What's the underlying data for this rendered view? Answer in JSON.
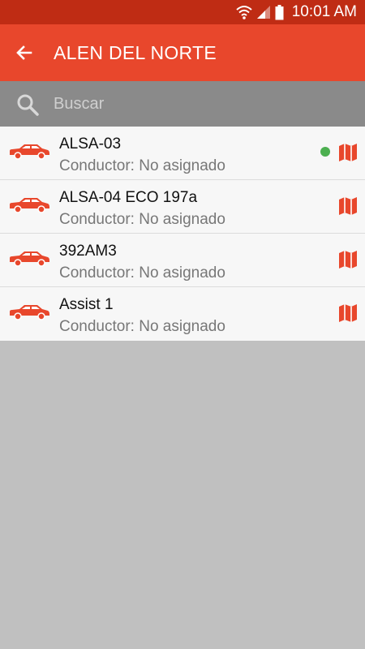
{
  "status_bar": {
    "time": "10:01 AM",
    "icons": [
      "wifi-icon",
      "signal-icon",
      "battery-icon"
    ]
  },
  "app_bar": {
    "back_icon": "arrow-left-icon",
    "title": "ALEN DEL NORTE"
  },
  "search": {
    "placeholder": "Buscar",
    "value": ""
  },
  "vehicles": [
    {
      "name": "ALSA-03",
      "driver": "Conductor: No asignado",
      "online": true
    },
    {
      "name": "ALSA-04 ECO 197a",
      "driver": "Conductor: No asignado",
      "online": false
    },
    {
      "name": "392AM3",
      "driver": "Conductor: No asignado",
      "online": false
    },
    {
      "name": "Assist 1",
      "driver": "Conductor: No asignado",
      "online": false
    }
  ],
  "colors": {
    "status_bar": "#bf2c14",
    "app_bar": "#e8472c",
    "search_bar": "#8a8a8a",
    "accent": "#e8472c",
    "online": "#4caf50",
    "background": "#c0c0c0"
  }
}
